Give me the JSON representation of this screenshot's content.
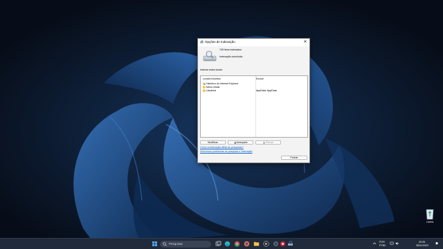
{
  "dialog": {
    "title": "Opções de Indexação",
    "close_glyph": "✕",
    "items_indexed": "745 itens indexados",
    "status": "Indexação concluída.",
    "index_label": "Indexar estes locais:",
    "columns": {
      "included": "Locais Incluídos",
      "exclude": "Excluir"
    },
    "rows": [
      {
        "name": "Histórico do Internet Explorer",
        "exclude": "",
        "icon": "ie-history-icon"
      },
      {
        "name": "Menu Iniciar",
        "exclude": "",
        "icon": "folder-icon"
      },
      {
        "name": "Usuários",
        "exclude": "AppData; AppData",
        "icon": "folder-icon"
      }
    ],
    "buttons": {
      "modify": "Modificar",
      "advanced": "Avançado",
      "pause": "Pausar",
      "close": "Fechar"
    },
    "links": {
      "how_affects": "Como a indexação afeta as pesquisas?",
      "troubleshoot": "Solucionar problemas de pesquisa e indexação"
    }
  },
  "desktop": {
    "recycle_bin_label": "Lixeira"
  },
  "taskbar": {
    "search_placeholder": "Pesquisar",
    "language": "POR",
    "layout": "PTB2",
    "time": "20:26",
    "date": "26/11/2023",
    "items": [
      "start-icon",
      "search-box",
      "task-view-icon",
      "edge-icon",
      "chrome-icon",
      "firefox-icon",
      "file-explorer-icon",
      "media-player-icon",
      "settings-icon",
      "vpn-icon",
      "indexing-options-icon"
    ]
  }
}
